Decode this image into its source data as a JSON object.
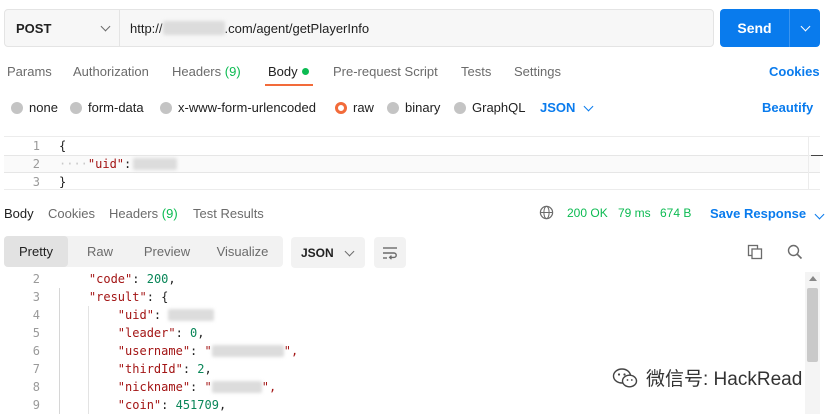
{
  "request": {
    "method": "POST",
    "url_prefix": "http://",
    "url_suffix": ".com/agent/getPlayerInfo",
    "send_label": "Send"
  },
  "request_tabs": {
    "params": "Params",
    "authorization": "Authorization",
    "headers": "Headers",
    "headers_count": "(9)",
    "body": "Body",
    "pre_request": "Pre-request Script",
    "tests": "Tests",
    "settings": "Settings",
    "cookies": "Cookies"
  },
  "body_types": {
    "none": "none",
    "form_data": "form-data",
    "urlencoded": "x-www-form-urlencoded",
    "raw": "raw",
    "binary": "binary",
    "graphql": "GraphQL",
    "language": "JSON",
    "beautify": "Beautify",
    "selected": "raw"
  },
  "request_body": {
    "lines": [
      {
        "num": "1",
        "text": "{"
      },
      {
        "num": "2",
        "key": "\"uid\"",
        "sep": ":"
      },
      {
        "num": "3",
        "text": "}"
      }
    ]
  },
  "response_tabs": {
    "body": "Body",
    "cookies": "Cookies",
    "headers": "Headers",
    "headers_count": "(9)",
    "test_results": "Test Results",
    "status": "200 OK",
    "time": "79 ms",
    "size": "674 B",
    "save_response": "Save Response"
  },
  "response_toolbar": {
    "pretty": "Pretty",
    "raw": "Raw",
    "preview": "Preview",
    "visualize": "Visualize",
    "format": "JSON"
  },
  "response_body": {
    "lines": [
      {
        "num": "2",
        "indent": "    ",
        "key": "\"code\"",
        "sep": ": ",
        "val": "200",
        "tail": ","
      },
      {
        "num": "3",
        "indent": "    ",
        "key": "\"result\"",
        "sep": ": ",
        "val": "",
        "tail": "{"
      },
      {
        "num": "4",
        "indent": "        ",
        "key": "\"uid\"",
        "sep": ": ",
        "val": "",
        "tail": ""
      },
      {
        "num": "5",
        "indent": "        ",
        "key": "\"leader\"",
        "sep": ": ",
        "val": "0",
        "tail": ","
      },
      {
        "num": "6",
        "indent": "        ",
        "key": "\"username\"",
        "sep": ": ",
        "val": "\"",
        "tail": "\","
      },
      {
        "num": "7",
        "indent": "        ",
        "key": "\"thirdId\"",
        "sep": ": ",
        "val": "2",
        "tail": ","
      },
      {
        "num": "8",
        "indent": "        ",
        "key": "\"nickname\"",
        "sep": ": ",
        "val": "\"",
        "tail": "\","
      },
      {
        "num": "9",
        "indent": "        ",
        "key": "\"coin\"",
        "sep": ": ",
        "val": "451709",
        "tail": ","
      }
    ]
  },
  "watermark": {
    "text": "微信号: HackRead"
  },
  "colors": {
    "accent": "#f26b3a",
    "brand_blue": "#097bed",
    "success_green": "#0cbb52",
    "json_key": "#a31515",
    "json_number": "#098658"
  }
}
